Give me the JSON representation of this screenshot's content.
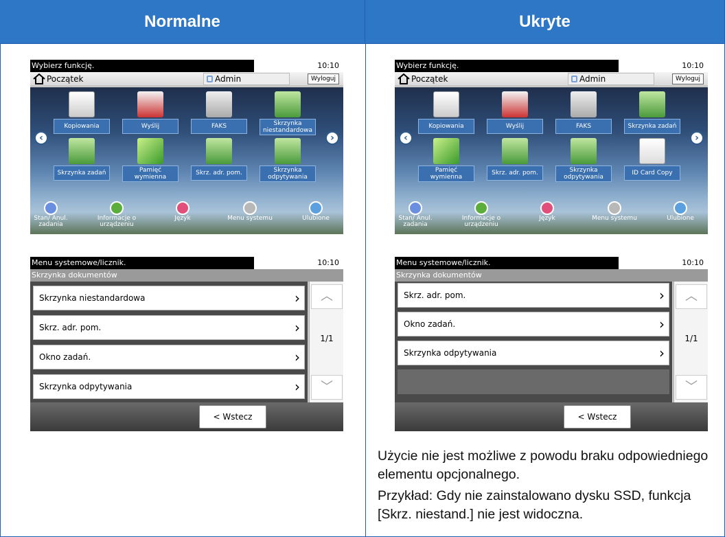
{
  "headers": {
    "left": "Normalne",
    "right": "Ukryte"
  },
  "home_screen": {
    "title": "Wybierz funkcję.",
    "time": "10:10",
    "home_label": "Początek",
    "user": "Admin",
    "logout": "Wyloguj",
    "dock": [
      "Stan/ Anul. zadania",
      "Informacje o urządzeniu",
      "Język",
      "Menu systemu",
      "Ulubione"
    ]
  },
  "normal_tiles": [
    "Kopiowania",
    "Wyślij",
    "FAKS",
    "Skrzynka niestandardowa",
    "Skrzynka zadań",
    "Pamięć wymienna",
    "Skrz. adr. pom.",
    "Skrzynka odpytywania"
  ],
  "hidden_tiles": [
    "Kopiowania",
    "Wyślij",
    "FAKS",
    "Skrzynka zadań",
    "Pamięć wymienna",
    "Skrz. adr. pom.",
    "Skrzynka odpytywania",
    "ID Card Copy"
  ],
  "menu_screen": {
    "title": "Menu systemowe/licznik.",
    "time": "10:10",
    "subtitle": "Skrzynka dokumentów",
    "page": "1/1",
    "back": "< Wstecz"
  },
  "normal_list": [
    "Skrzynka niestandardowa",
    "Skrz. adr. pom.",
    "Okno zadań.",
    "Skrzynka odpytywania"
  ],
  "hidden_list": [
    "Skrz. adr. pom.",
    "Okno zadań.",
    "Skrzynka odpytywania"
  ],
  "note": {
    "line1": "Użycie nie jest możliwe z powodu braku odpowiedniego elementu opcjonalnego.",
    "line2": "Przykład: Gdy nie zainstalowano dysku SSD, funkcja [Skrz. niestand.] nie jest widoczna."
  }
}
